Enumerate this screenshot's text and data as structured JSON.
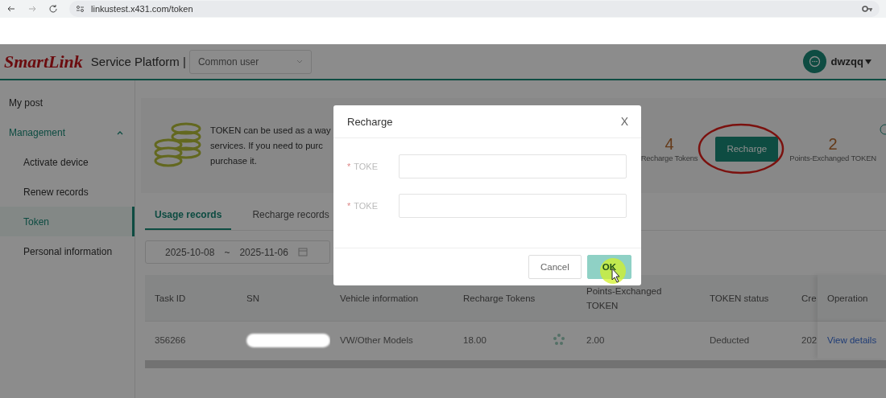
{
  "browser": {
    "url": "linkustest.x431.com/token"
  },
  "header": {
    "logo": "SmartLink",
    "platform_title": "Service Platform |",
    "role_select": {
      "value": "Common user"
    },
    "user": {
      "name": "dwzqq"
    }
  },
  "sidebar": {
    "items": [
      {
        "label": "My post",
        "selected": false
      },
      {
        "label": "Management",
        "selected": false,
        "expanded": true,
        "children": [
          {
            "label": "Activate device",
            "selected": false
          },
          {
            "label": "Renew records",
            "selected": false
          },
          {
            "label": "Token",
            "selected": true
          },
          {
            "label": "Personal information",
            "selected": false
          }
        ]
      }
    ]
  },
  "banner": {
    "lines": [
      "TOKEN can be used as a way",
      "services. If you need to purc",
      "purchase it."
    ],
    "stats": [
      {
        "kind": "stat",
        "value": "4",
        "label": "Recharge Tokens"
      },
      {
        "kind": "button",
        "label": "Recharge",
        "circled": true
      },
      {
        "kind": "stat",
        "value": "2",
        "label": "Points-Exchanged TOKEN"
      }
    ]
  },
  "tabs": [
    {
      "label": "Usage records",
      "selected": true
    },
    {
      "label": "Recharge records",
      "selected": false
    }
  ],
  "date_range": {
    "start": "2025-10-08",
    "separator": "~",
    "end": "2025-11-06"
  },
  "table": {
    "columns": [
      "Task ID",
      "SN",
      "Vehicle information",
      "Recharge Tokens",
      "Points-Exchanged TOKEN",
      "TOKEN status",
      "Cre",
      "Operation"
    ],
    "rows": [
      {
        "task_id": "356266",
        "sn_redacted": true,
        "vehicle": "VW/Other Models",
        "recharge_tokens": "18.00",
        "loading": true,
        "points_token": "2.00",
        "status": "Deducted",
        "created": "202",
        "operation": "View details"
      }
    ]
  },
  "modal": {
    "title": "Recharge",
    "close": "X",
    "fields": [
      {
        "required_mark": "*",
        "label": "TOKE"
      },
      {
        "required_mark": "*",
        "label": "TOKE"
      }
    ],
    "buttons": [
      {
        "kind": "default",
        "label": "Cancel"
      },
      {
        "kind": "primary",
        "label": "OK",
        "pointer": true
      }
    ]
  }
}
